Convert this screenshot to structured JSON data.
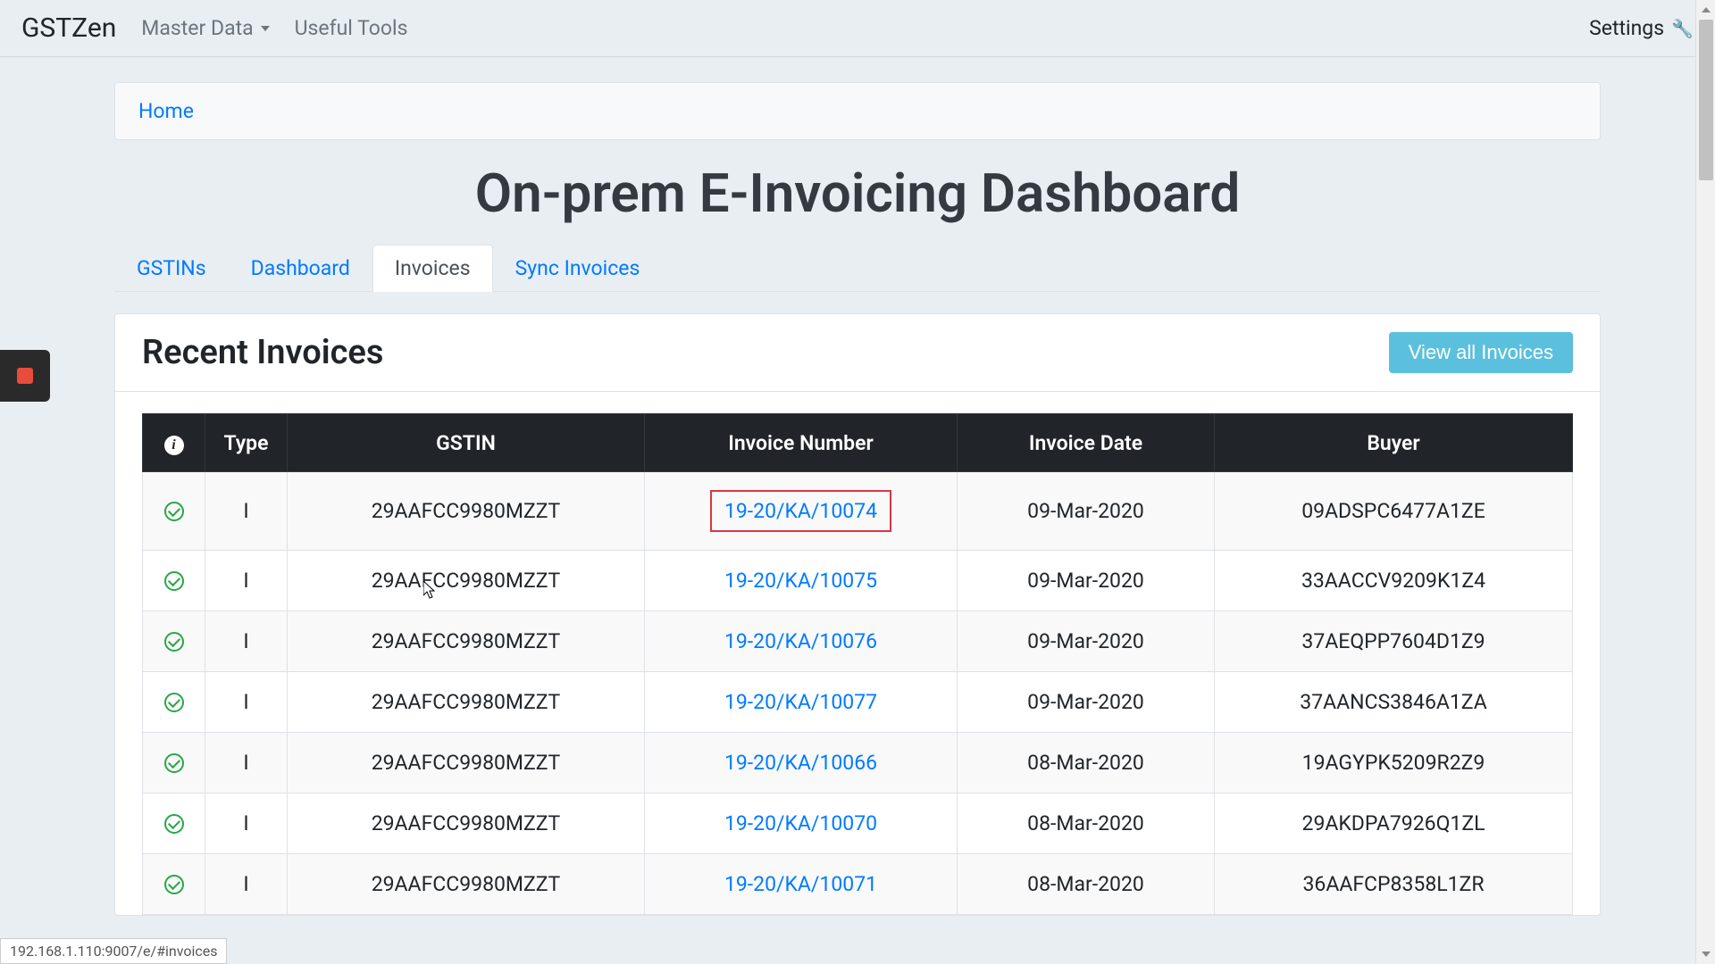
{
  "nav": {
    "brand": "GSTZen",
    "master_data": "Master Data",
    "useful_tools": "Useful Tools",
    "settings": "Settings"
  },
  "breadcrumb": {
    "home": "Home"
  },
  "page_title": "On-prem E-Invoicing Dashboard",
  "tabs": {
    "gstins": "GSTINs",
    "dashboard": "Dashboard",
    "invoices": "Invoices",
    "sync": "Sync Invoices"
  },
  "card": {
    "title": "Recent Invoices",
    "view_all": "View all Invoices"
  },
  "table": {
    "headers": {
      "type": "Type",
      "gstin": "GSTIN",
      "invoice_number": "Invoice Number",
      "invoice_date": "Invoice Date",
      "buyer": "Buyer"
    },
    "rows": [
      {
        "type": "I",
        "gstin": "29AAFCC9980MZZT",
        "invoice_number": "19-20/KA/10074",
        "invoice_date": "09-Mar-2020",
        "buyer": "09ADSPC6477A1ZE",
        "highlighted": true
      },
      {
        "type": "I",
        "gstin": "29AAFCC9980MZZT",
        "invoice_number": "19-20/KA/10075",
        "invoice_date": "09-Mar-2020",
        "buyer": "33AACCV9209K1Z4"
      },
      {
        "type": "I",
        "gstin": "29AAFCC9980MZZT",
        "invoice_number": "19-20/KA/10076",
        "invoice_date": "09-Mar-2020",
        "buyer": "37AEQPP7604D1Z9"
      },
      {
        "type": "I",
        "gstin": "29AAFCC9980MZZT",
        "invoice_number": "19-20/KA/10077",
        "invoice_date": "09-Mar-2020",
        "buyer": "37AANCS3846A1ZA"
      },
      {
        "type": "I",
        "gstin": "29AAFCC9980MZZT",
        "invoice_number": "19-20/KA/10066",
        "invoice_date": "08-Mar-2020",
        "buyer": "19AGYPK5209R2Z9"
      },
      {
        "type": "I",
        "gstin": "29AAFCC9980MZZT",
        "invoice_number": "19-20/KA/10070",
        "invoice_date": "08-Mar-2020",
        "buyer": "29AKDPA7926Q1ZL"
      },
      {
        "type": "I",
        "gstin": "29AAFCC9980MZZT",
        "invoice_number": "19-20/KA/10071",
        "invoice_date": "08-Mar-2020",
        "buyer": "36AAFCP8358L1ZR"
      }
    ]
  },
  "status_bar": "192.168.1.110:9007/e/#invoices"
}
